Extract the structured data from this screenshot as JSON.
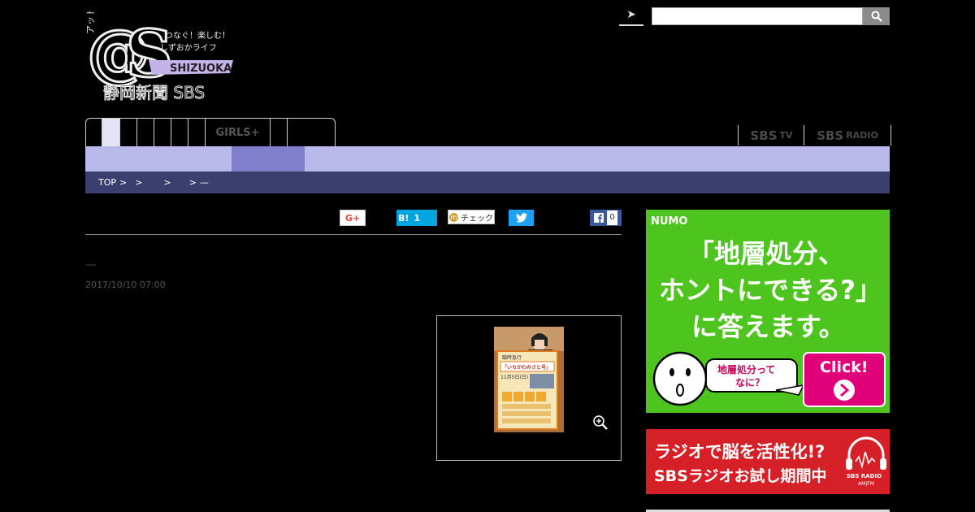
{
  "header": {
    "logo": {
      "name": "@S SHIZUOKA",
      "katakana": "アットエス",
      "tagline_line1": "つなぐ！楽しむ！",
      "tagline_line2": "しずおかライフ",
      "region": "SHIZUOKA",
      "publisher": "静岡新聞 SBS"
    },
    "search": {
      "placeholder": "",
      "value": ""
    }
  },
  "nav": {
    "tabs": [
      {
        "label": ""
      },
      {
        "label": ""
      },
      {
        "label": ""
      },
      {
        "label": ""
      },
      {
        "label": ""
      },
      {
        "label": ""
      },
      {
        "label": ""
      },
      {
        "label": "GIRLS+"
      },
      {
        "label": ""
      },
      {
        "label": ""
      }
    ],
    "active_index": 1,
    "sbs_tv": {
      "main": "SBS",
      "sub": "TV"
    },
    "sbs_radio": {
      "main": "SBS",
      "sub": "RADIO"
    }
  },
  "breadcrumb": {
    "items": [
      "TOP",
      ">",
      ">",
      ">",
      ">",
      "—"
    ]
  },
  "share": {
    "gplus_label": "G+",
    "hatena_label": "B!",
    "hatena_count": "1",
    "mixi_label": "チェック",
    "facebook_count": "0"
  },
  "article": {
    "title": "—",
    "date": "2017/10/10 07:00"
  },
  "photo": {
    "poster_line1": "臨時急行",
    "poster_line2": "「いちかわみさと号」",
    "poster_line3": "11月5日(日)"
  },
  "ads": {
    "numo": {
      "brand": "NUMO",
      "headline_line1": "「地層処分、",
      "headline_line2": "ホントにできる?」",
      "headline_line3": "に答えます。",
      "bubble_line1": "地層処分って",
      "bubble_line2": "なに？",
      "cta": "Click!"
    },
    "radio": {
      "line1": "ラジオで脳を活性化!?",
      "line2": "SBSラジオお試し期間中",
      "badge_main": "SBS RADIO",
      "badge_sub": "AM|FM"
    }
  },
  "colors": {
    "subnav": "#b9b9ec",
    "subnav_active": "#7f7fcb",
    "breadcrumb": "#3a3f6e",
    "numo_green": "#4ec51f",
    "radio_red": "#d52028"
  }
}
